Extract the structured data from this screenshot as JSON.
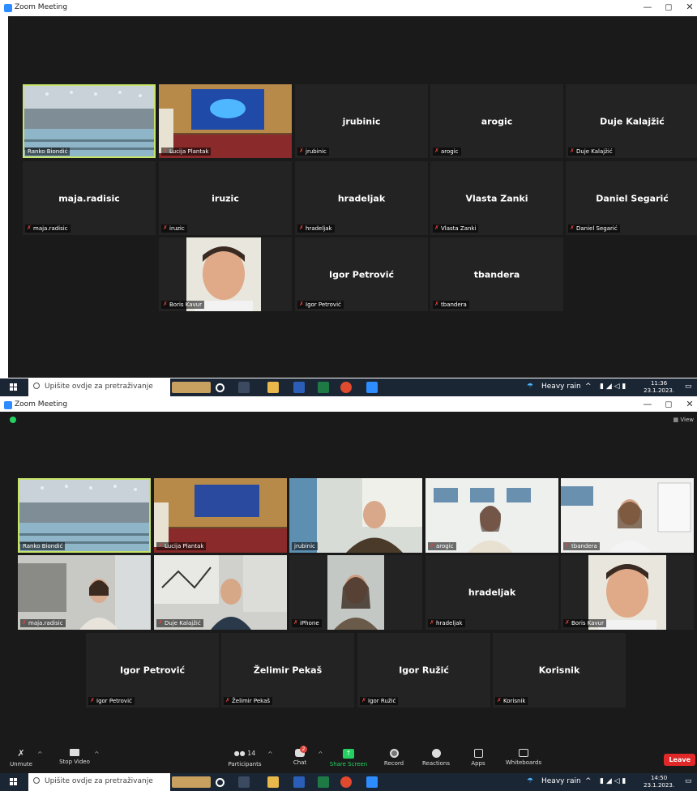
{
  "window": {
    "title": "Zoom Meeting",
    "minimize": "—",
    "maximize": "◻",
    "close": "✕"
  },
  "screen1": {
    "tiles": [
      {
        "center": "",
        "label": "Ranko Biondić",
        "muted": false,
        "kind": "video-room"
      },
      {
        "center": "",
        "label": "Lucija Plantak",
        "muted": true,
        "kind": "video-stage"
      },
      {
        "center": "jrubinic",
        "label": "jrubinic",
        "muted": true
      },
      {
        "center": "arogic",
        "label": "arogic",
        "muted": true
      },
      {
        "center": "Duje Kalajžić",
        "label": "Duje Kalajžić",
        "muted": true
      },
      {
        "center": "maja.radisic",
        "label": "maja.radisic",
        "muted": true
      },
      {
        "center": "iruzic",
        "label": "iruzic",
        "muted": true
      },
      {
        "center": "hradeljak",
        "label": "hradeljak",
        "muted": true
      },
      {
        "center": "Vlasta Zanki",
        "label": "Vlasta Zanki",
        "muted": true
      },
      {
        "center": "Daniel Segarić",
        "label": "Daniel Segarić",
        "muted": true
      },
      {
        "center": "",
        "label": "Boris Kavur",
        "muted": true,
        "kind": "photo"
      },
      {
        "center": "Igor Petrović",
        "label": "Igor Petrović",
        "muted": true
      },
      {
        "center": "tbandera",
        "label": "tbandera",
        "muted": true
      }
    ],
    "taskbar": {
      "search_placeholder": "Upišite ovdje za pretraživanje",
      "weather": "Heavy rain",
      "time": "11:36",
      "date": "23.1.2023."
    }
  },
  "screen2": {
    "view_label": "View",
    "tiles": [
      {
        "center": "",
        "label": "Ranko Biondić",
        "muted": false,
        "kind": "video-room"
      },
      {
        "center": "",
        "label": "Lucija Plantak",
        "muted": true,
        "kind": "video-stage"
      },
      {
        "center": "",
        "label": "jrubinic",
        "muted": false,
        "kind": "video-person"
      },
      {
        "center": "",
        "label": "arogic",
        "muted": true,
        "kind": "video-person"
      },
      {
        "center": "",
        "label": "tbandera",
        "muted": true,
        "kind": "video-person"
      },
      {
        "center": "",
        "label": "maja.radisic",
        "muted": true,
        "kind": "video-person"
      },
      {
        "center": "",
        "label": "Duje Kalajžić",
        "muted": true,
        "kind": "video-person"
      },
      {
        "center": "",
        "label": "iPhone",
        "muted": true,
        "kind": "video-person"
      },
      {
        "center": "hradeljak",
        "label": "hradeljak",
        "muted": true
      },
      {
        "center": "",
        "label": "Boris Kavur",
        "muted": true,
        "kind": "photo"
      },
      {
        "center": "Igor Petrović",
        "label": "Igor Petrović",
        "muted": true
      },
      {
        "center": "Želimir Pekaš",
        "label": "Želimir Pekaš",
        "muted": true
      },
      {
        "center": "Igor Ružić",
        "label": "Igor Ružić",
        "muted": true
      },
      {
        "center": "Korisnik",
        "label": "Korisnik",
        "muted": true
      }
    ],
    "toolbar": {
      "unmute": "Unmute",
      "stop_video": "Stop Video",
      "participants": "Participants",
      "participants_count": "14",
      "chat": "Chat",
      "chat_badge": "2",
      "share_screen": "Share Screen",
      "record": "Record",
      "reactions": "Reactions",
      "apps": "Apps",
      "whiteboards": "Whiteboards",
      "leave": "Leave"
    },
    "taskbar": {
      "search_placeholder": "Upišite ovdje za pretraživanje",
      "weather": "Heavy rain",
      "time": "14:50",
      "date": "23.1.2023."
    }
  },
  "colors": {
    "active_speaker": "#c6e36a",
    "muted_red": "#e0463d",
    "share_green": "#23d160",
    "leave_red": "#e02828",
    "tile_bg": "#232323",
    "meeting_bg": "#1a1a1a"
  }
}
